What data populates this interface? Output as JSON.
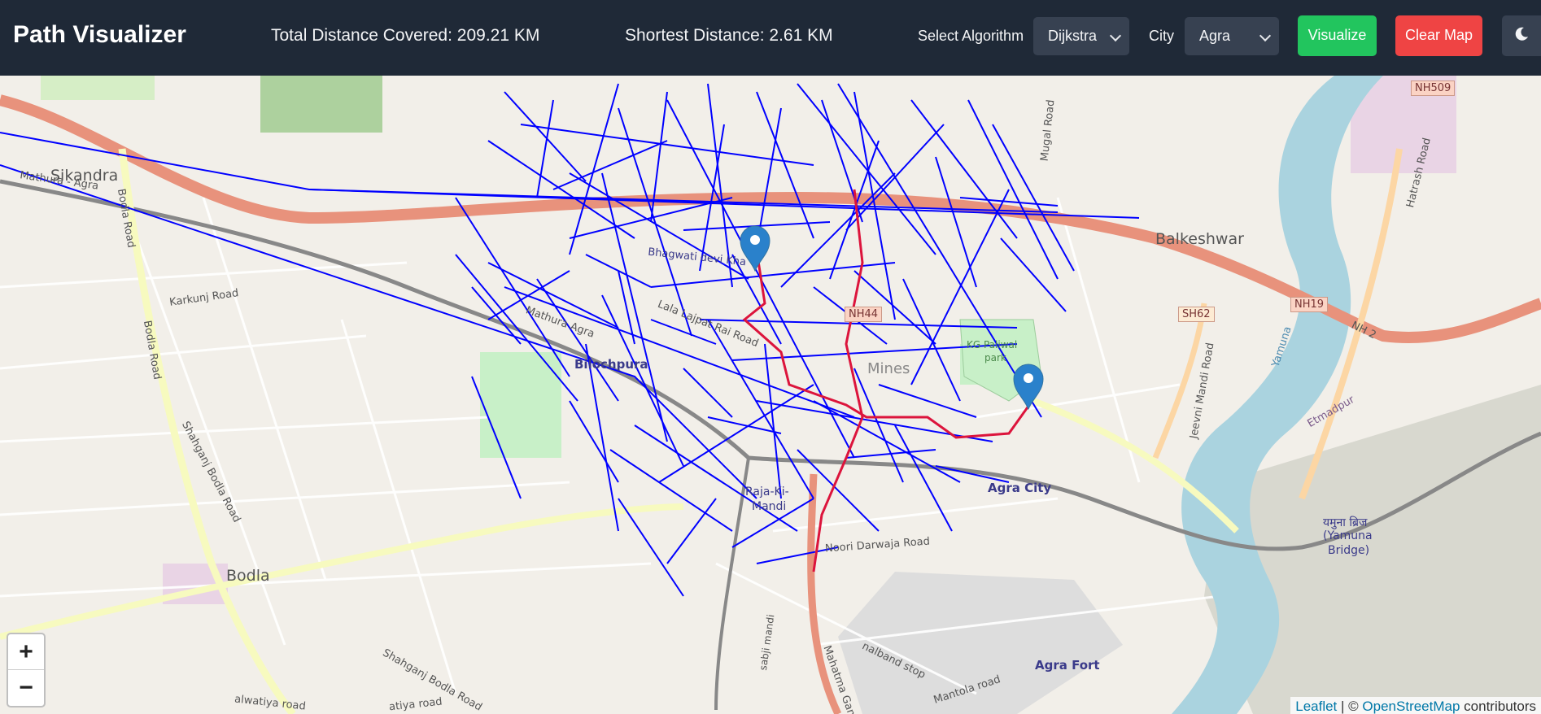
{
  "header": {
    "title": "Path Visualizer",
    "total_distance": "Total Distance Covered: 209.21 KM",
    "shortest_distance": "Shortest Distance: 2.61 KM",
    "algorithm_label": "Select Algorithm",
    "algorithm_value": "Dijkstra",
    "city_label": "City",
    "city_value": "Agra",
    "visualize_label": "Visualize",
    "clear_label": "Clear Map",
    "theme_icon": "moon-icon"
  },
  "colors": {
    "header_bg": "#1f2937",
    "visualize": "#22c55e",
    "clear": "#ef4444",
    "explored": "#0000ff",
    "shortest_path": "#dc143c",
    "marker": "#2a81cb"
  },
  "map": {
    "labels": {
      "sikandra": "Sikandra",
      "mathura_agra": "Mathura - Agra",
      "bodla_road_top": "Bodla Road",
      "karkunj": "Karkunj Road",
      "bodla_road": "Bodla Road",
      "shahganj_bodla": "Shahganj Bodla Road",
      "bodla": "Bodla",
      "shahganj_bodla_2": "Shahganj Bodla Road",
      "alwatiya": "alwatiya road",
      "alwatiya_2": "atiya road",
      "bagichi": "Bhagwati devi Kha",
      "lala_lajpat": "Lala Lajpat Rai Road",
      "mathura_agra_2": "Mathura Agra",
      "bilochpura": "Bilochpura",
      "nh44": "NH44",
      "raja_ki_mandi_1": "Raja-Ki-",
      "raja_ki_mandi_2": "Mandi",
      "noori": "Noori Darwaja Road",
      "sabji": "sabji mandi",
      "mg_road": "Mahatma Gandhi Ro",
      "nalband": "nalband stop",
      "mantola": "Mantola road",
      "agra_city": "Agra City",
      "agra_fort": "Agra Fort",
      "balkeshwar": "Balkeshwar",
      "nh509": "NH509",
      "hatrash": "Hatrash Road",
      "sh62": "SH62",
      "nh19": "NH19",
      "nh2": "NH 2",
      "jeevni": "Jeevni Mandi Road",
      "yamuna": "Yamuna",
      "etmadpur": "Etmadpur",
      "bridge_1": "यमुना ब्रिज",
      "bridge_2": "(Yamuna",
      "bridge_3": "Bridge)",
      "mugal": "Mugal Road",
      "park_1": "KG Paliwal",
      "park_2": "park",
      "mines": "Mines"
    },
    "markers": [
      "start-marker",
      "end-marker"
    ]
  },
  "zoom": {
    "in": "+",
    "out": "−"
  },
  "attribution": {
    "leaflet": "Leaflet",
    "sep": "| ©",
    "osm": "OpenStreetMap",
    "contrib": "contributors"
  }
}
